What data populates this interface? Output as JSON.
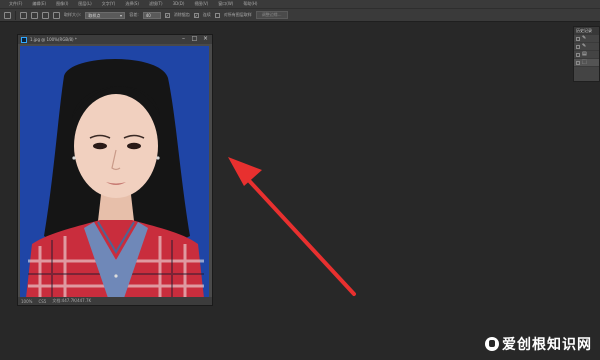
{
  "menubar": {
    "items": [
      "文件(F)",
      "编辑(E)",
      "图像(I)",
      "图层(L)",
      "文字(Y)",
      "选择(S)",
      "滤镜(T)",
      "3D(D)",
      "视图(V)",
      "窗口(W)",
      "帮助(H)"
    ]
  },
  "options": {
    "sample_size_label": "取样大小:",
    "sample_size_value": "取样点",
    "tolerance_label": "容差:",
    "tolerance_value": "40",
    "antialias_label": "消除锯齿",
    "contiguous_label": "连续",
    "sample_all_label": "对所有图层取样",
    "refine_edge_label": "调整边缘..."
  },
  "document": {
    "title": "1.jpg @ 100%(RGB/8) *",
    "zoom": "100%",
    "mode": "CS5",
    "doc_size": "文档:447.7K/447.7K",
    "canvas_bg": "#1f45a6"
  },
  "history_panel": {
    "tab_label": "历史记录",
    "rows": [
      {
        "icon": "magic-wand-icon",
        "glyph": "✎"
      },
      {
        "icon": "magic-wand-icon",
        "glyph": "✎"
      },
      {
        "icon": "layer-icon",
        "glyph": "▤"
      },
      {
        "icon": "selection-icon",
        "glyph": "⬚"
      }
    ]
  },
  "annotation": {
    "arrow_color": "#e8302f"
  },
  "watermark": {
    "text": "爱创根知识网"
  }
}
